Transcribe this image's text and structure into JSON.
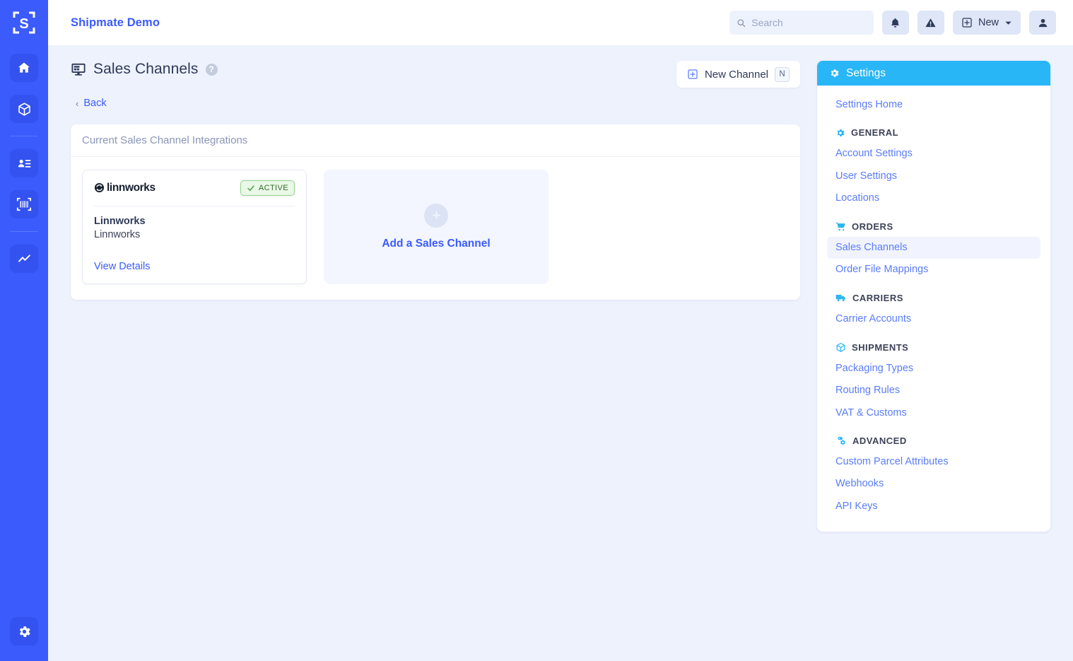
{
  "rail": {
    "logo_icon": "shipmate-s-logo",
    "items": [
      {
        "name": "home",
        "icon": "home-icon"
      },
      {
        "name": "shipments",
        "icon": "package-box-icon"
      },
      {
        "name": "contacts",
        "icon": "contact-list-icon"
      },
      {
        "name": "scan",
        "icon": "barcode-scan-icon"
      },
      {
        "name": "analytics",
        "icon": "trending-chart-icon"
      }
    ],
    "bottom": {
      "name": "settings",
      "icon": "gear-icon"
    }
  },
  "topbar": {
    "brand": "Shipmate Demo",
    "search": {
      "value": "",
      "placeholder": "Search",
      "icon": "search-icon"
    },
    "notifications_icon": "bell-icon",
    "alerts_icon": "warning-triangle-icon",
    "new_button": {
      "label": "New",
      "icon": "plus-square-icon",
      "caret": "chevron-down-icon"
    },
    "account_icon": "user-avatar-icon"
  },
  "page": {
    "title": "Sales Channels",
    "title_icon": "monitor-display-icon",
    "help_icon": "question-mark-icon",
    "help_glyph": "?",
    "back_label": "Back",
    "back_chevron": "‹",
    "new_channel": {
      "label": "New Channel",
      "icon": "plus-square-icon",
      "shortcut": "N"
    }
  },
  "panel": {
    "header": "Current Sales Channel Integrations",
    "integration": {
      "logo_text": "linnworks",
      "logo_icon": "linnworks-circular-arrows-icon",
      "status": {
        "label": "ACTIVE",
        "icon": "check-icon",
        "color": "#2f6e2a",
        "border": "#8fd08a",
        "background": "#eaf8e7"
      },
      "name": "Linnworks",
      "type": "Linnworks",
      "link": "View Details"
    },
    "add_card": {
      "label": "Add a Sales Channel",
      "icon": "plus-icon"
    }
  },
  "settings": {
    "header": "Settings",
    "header_icon": "gear-icon",
    "header_color": "#29b6f6",
    "home_link": "Settings Home",
    "groups": [
      {
        "title": "GENERAL",
        "icon": "gear-icon",
        "items": [
          "Account Settings",
          "User Settings",
          "Locations"
        ]
      },
      {
        "title": "ORDERS",
        "icon": "shopping-cart-icon",
        "items": [
          "Sales Channels",
          "Order File Mappings"
        ],
        "active": "Sales Channels"
      },
      {
        "title": "CARRIERS",
        "icon": "truck-icon",
        "items": [
          "Carrier Accounts"
        ]
      },
      {
        "title": "SHIPMENTS",
        "icon": "package-box-icon",
        "items": [
          "Packaging Types",
          "Routing Rules",
          "VAT & Customs"
        ]
      },
      {
        "title": "ADVANCED",
        "icon": "gears-icon",
        "items": [
          "Custom Parcel Attributes",
          "Webhooks",
          "API Keys"
        ]
      }
    ]
  }
}
